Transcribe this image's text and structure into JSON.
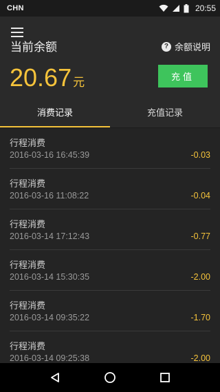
{
  "status": {
    "carrier": "CHN",
    "time": "20:55"
  },
  "header": {
    "title": "当前余额",
    "help_label": "余额说明",
    "balance": "20.67",
    "unit": "元",
    "recharge_label": "充值"
  },
  "tabs": [
    {
      "label": "消费记录",
      "active": true
    },
    {
      "label": "充值记录",
      "active": false
    }
  ],
  "records": [
    {
      "type": "行程消费",
      "date": "2016-03-16 16:45:39",
      "amount": "-0.03"
    },
    {
      "type": "行程消费",
      "date": "2016-03-16 11:08:22",
      "amount": "-0.04"
    },
    {
      "type": "行程消费",
      "date": "2016-03-14 17:12:43",
      "amount": "-0.77"
    },
    {
      "type": "行程消费",
      "date": "2016-03-14 15:30:35",
      "amount": "-2.00"
    },
    {
      "type": "行程消费",
      "date": "2016-03-14 09:35:22",
      "amount": "-1.70"
    },
    {
      "type": "行程消费",
      "date": "2016-03-14 09:25:38",
      "amount": "-2.00"
    }
  ],
  "colors": {
    "accent": "#f5c33b",
    "button": "#3ec45c",
    "background": "#242424"
  }
}
